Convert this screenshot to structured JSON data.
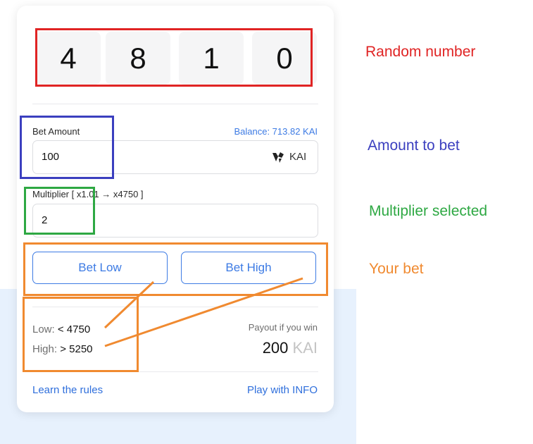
{
  "digits": [
    "4",
    "8",
    "1",
    "0"
  ],
  "bet": {
    "label": "Bet Amount",
    "balance": "Balance: 713.82 KAI",
    "value": "100",
    "currency": "KAI",
    "currency_icon": "kai-logo-icon"
  },
  "multiplier": {
    "label": "Multiplier [ x1.01 → x4750 ]",
    "value": "2"
  },
  "buttons": {
    "low": "Bet Low",
    "high": "Bet High"
  },
  "ranges": {
    "low_label": "Low:",
    "low_value": "< 4750",
    "high_label": "High:",
    "high_value": "> 5250"
  },
  "payout": {
    "label": "Payout if you win",
    "value": "200",
    "unit": "KAI"
  },
  "links": {
    "rules": "Learn the rules",
    "play": "Play with INFO"
  },
  "annotations": {
    "random": "Random number",
    "amount": "Amount to bet",
    "multiplier": "Multiplier selected",
    "bet": "Your bet"
  },
  "colors": {
    "accent": "#3d7be4",
    "annotation_red": "#e02424",
    "annotation_blue": "#3b3fbf",
    "annotation_green": "#2ea843",
    "annotation_orange": "#f08a30"
  }
}
